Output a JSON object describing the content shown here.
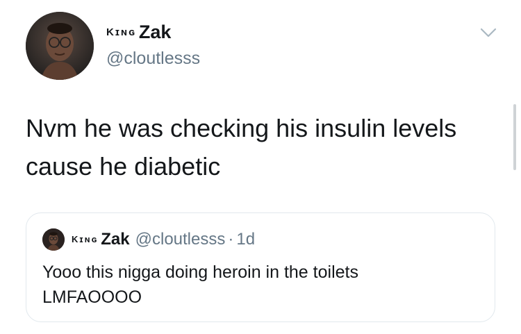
{
  "tweet": {
    "author": {
      "name_prefix": "Kɪɴɢ",
      "name_main": "Zak",
      "handle": "@cloutlesss"
    },
    "text_line1": "Nvm he was checking his insulin levels",
    "text_line2": "cause he diabetic",
    "menu_icon": "chevron-down-icon"
  },
  "quoted_tweet": {
    "author": {
      "name_prefix": "Kɪɴɢ",
      "name_main": "Zak",
      "handle": "@cloutlesss"
    },
    "separator": "·",
    "time": "1d",
    "text_line1": "Yooo this nigga doing heroin in the toilets",
    "text_line2": "LMFAOOOO"
  },
  "colors": {
    "text_primary": "#14171a",
    "text_secondary": "#657786",
    "border": "#e1e8ed",
    "background": "#ffffff"
  }
}
